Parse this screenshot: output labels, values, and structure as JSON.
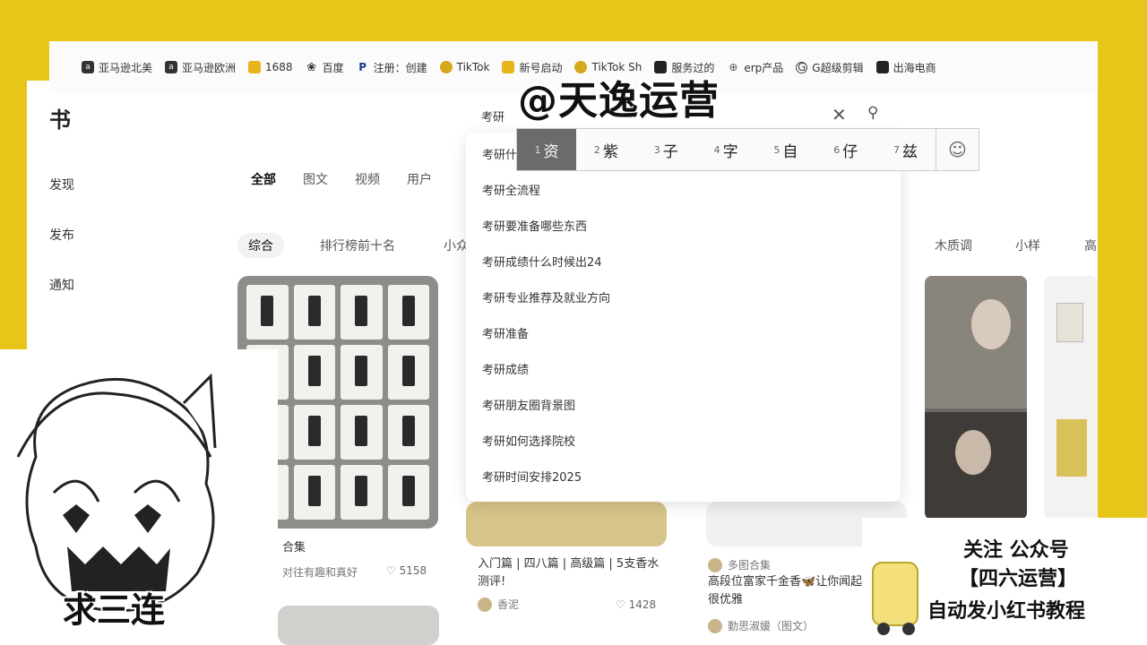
{
  "bookmarks": [
    {
      "label": "亚马逊北美",
      "icon": "amazon-icon"
    },
    {
      "label": "亚马逊欧洲",
      "icon": "amazon-icon"
    },
    {
      "label": "1688",
      "icon": "1688-icon"
    },
    {
      "label": "百度",
      "icon": "baidu-paw-icon"
    },
    {
      "label": "注册：创建",
      "icon": "paypal-icon"
    },
    {
      "label": "TikTok",
      "icon": "tiktok-icon"
    },
    {
      "label": "新号启动",
      "icon": "folder-icon"
    },
    {
      "label": "TikTok Sh",
      "icon": "tiktok-icon"
    },
    {
      "label": "服务过的",
      "icon": "folder-icon"
    },
    {
      "label": "erp产品",
      "icon": "link-icon"
    },
    {
      "label": "G超级剪辑",
      "icon": "g-icon"
    },
    {
      "label": "出海电商",
      "icon": "box-icon"
    }
  ],
  "left_nav": {
    "logo_fragment": "书",
    "items": [
      "发现",
      "发布",
      "通知"
    ]
  },
  "watermark": "@天逸运营",
  "search": {
    "query": "考研",
    "suggestions": [
      "考研什",
      "考研全流程",
      "考研要准备哪些东西",
      "考研成绩什么时候出24",
      "考研专业推荐及就业方向",
      "考研准备",
      "考研成绩",
      "考研朋友圈背景图",
      "考研如何选择院校",
      "考研时间安排2025"
    ]
  },
  "ime": {
    "candidates": [
      {
        "num": "1",
        "char": "资"
      },
      {
        "num": "2",
        "char": "紫"
      },
      {
        "num": "3",
        "char": "子"
      },
      {
        "num": "4",
        "char": "字"
      },
      {
        "num": "5",
        "char": "自"
      },
      {
        "num": "6",
        "char": "仔"
      },
      {
        "num": "7",
        "char": "兹"
      }
    ]
  },
  "tabs": [
    "全部",
    "图文",
    "视频",
    "用户"
  ],
  "filters": [
    "综合",
    "排行榜前十名",
    "小众",
    "木质调",
    "小样",
    "高"
  ],
  "cards": {
    "card1": {
      "title": "合集",
      "subtitle": "对往有趣和真好",
      "likes": "5158"
    },
    "card2": {
      "title": "入门篇 | 四八篇 | 高级篇 | 5支香水测评!",
      "author": "香泥",
      "likes": "1428"
    },
    "card3": {
      "author": "多图合集",
      "title": "高段位富家千金香🦋让你闻起来就很优雅",
      "meta": "勤思淑媛（图文）"
    }
  },
  "sticker_left": "求三连",
  "promo": {
    "line1": "关注 公众号",
    "line2": "【四六运营】",
    "line3": "自动发小红书教程"
  }
}
